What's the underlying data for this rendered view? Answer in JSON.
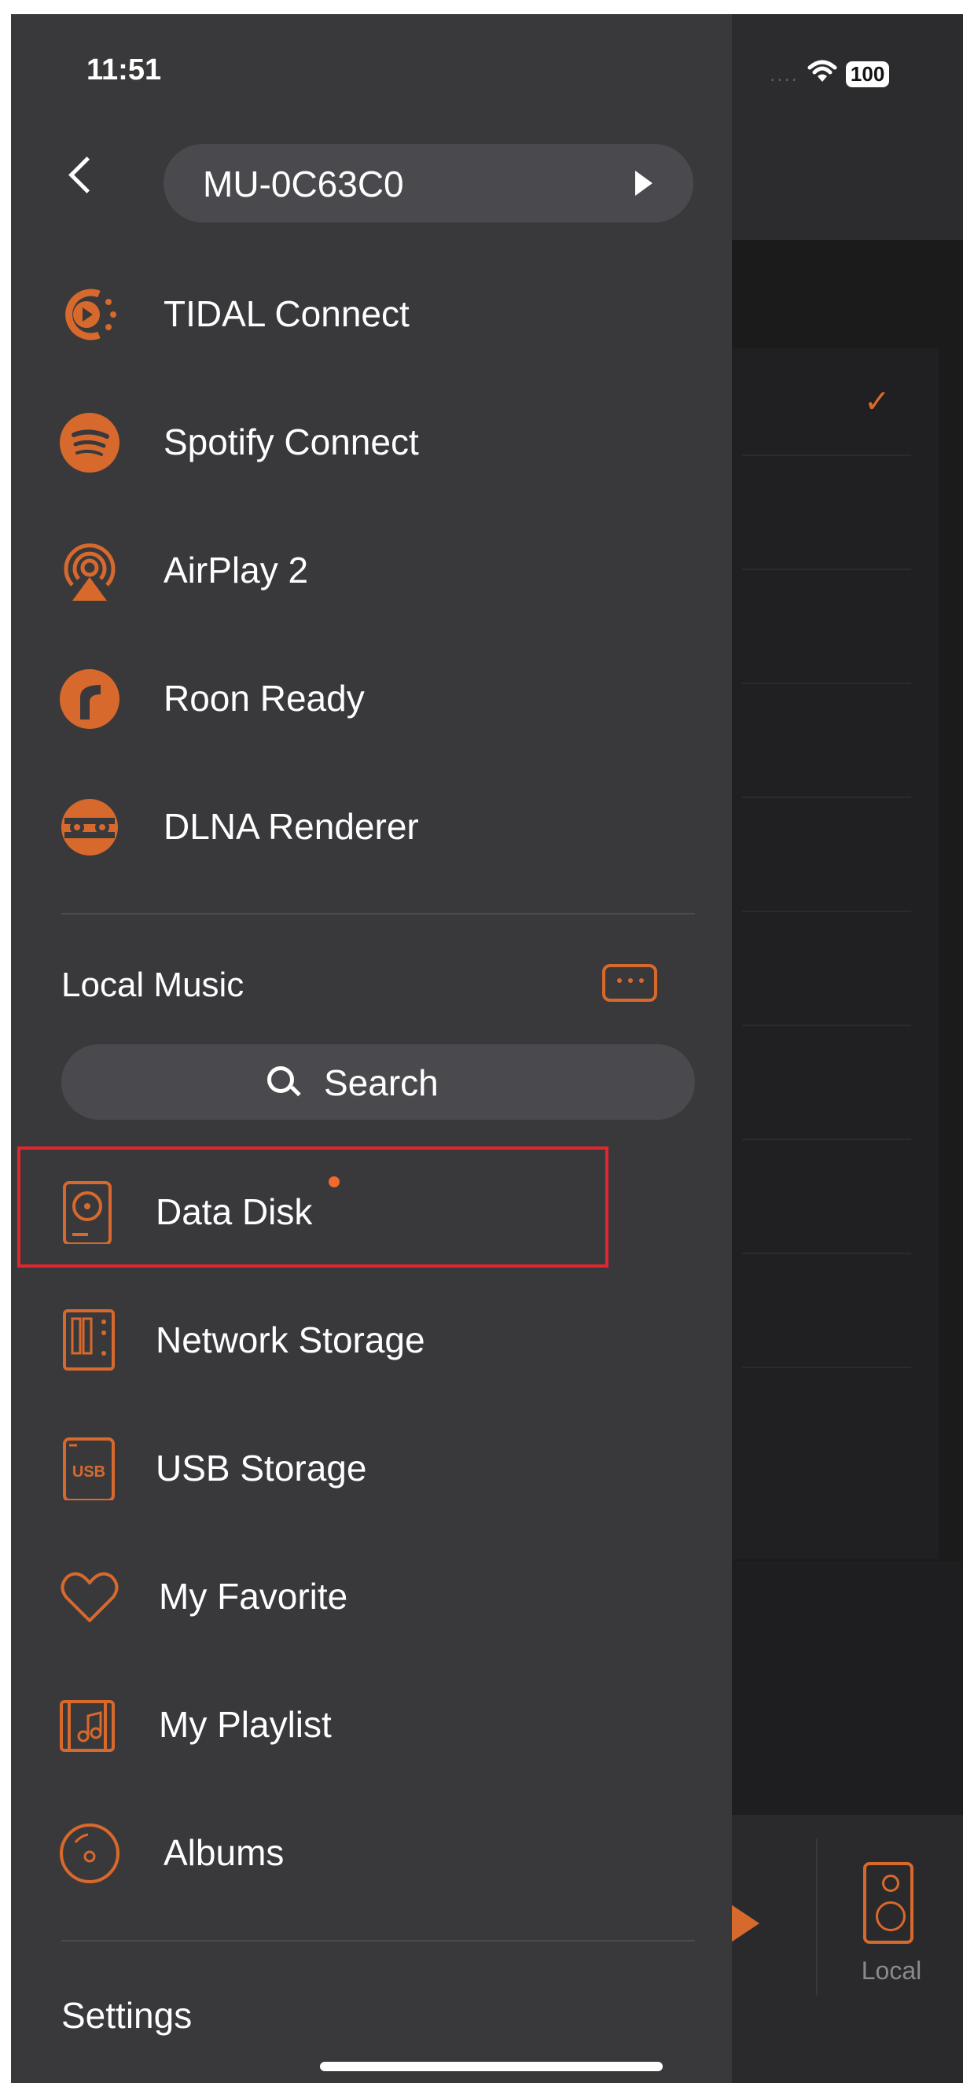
{
  "status_bar": {
    "time": "11:51",
    "battery": "100",
    "signal": "....",
    "wifi_icon": "wifi-icon"
  },
  "header": {
    "device_name": "MU-0C63C0"
  },
  "services": [
    {
      "label": "TIDAL Connect",
      "icon": "tidal-connect-icon"
    },
    {
      "label": "Spotify Connect",
      "icon": "spotify-icon"
    },
    {
      "label": "AirPlay 2",
      "icon": "airplay-icon"
    },
    {
      "label": "Roon Ready",
      "icon": "roon-icon"
    },
    {
      "label": "DLNA Renderer",
      "icon": "dlna-icon"
    }
  ],
  "local_music": {
    "title": "Local Music",
    "search_label": "Search",
    "items": [
      {
        "label": "Data Disk",
        "icon": "disk-icon",
        "highlighted": true,
        "badge_dot": true
      },
      {
        "label": "Network Storage",
        "icon": "nas-icon"
      },
      {
        "label": "USB Storage",
        "icon": "usb-icon"
      },
      {
        "label": "My Favorite",
        "icon": "heart-icon"
      },
      {
        "label": "My Playlist",
        "icon": "playlist-icon"
      },
      {
        "label": "Albums",
        "icon": "album-icon"
      }
    ]
  },
  "settings_label": "Settings",
  "background": {
    "footer_label": "Local"
  },
  "colors": {
    "accent": "#D8692C",
    "drawer_bg": "#39393C",
    "highlight_border": "#E2262E"
  }
}
